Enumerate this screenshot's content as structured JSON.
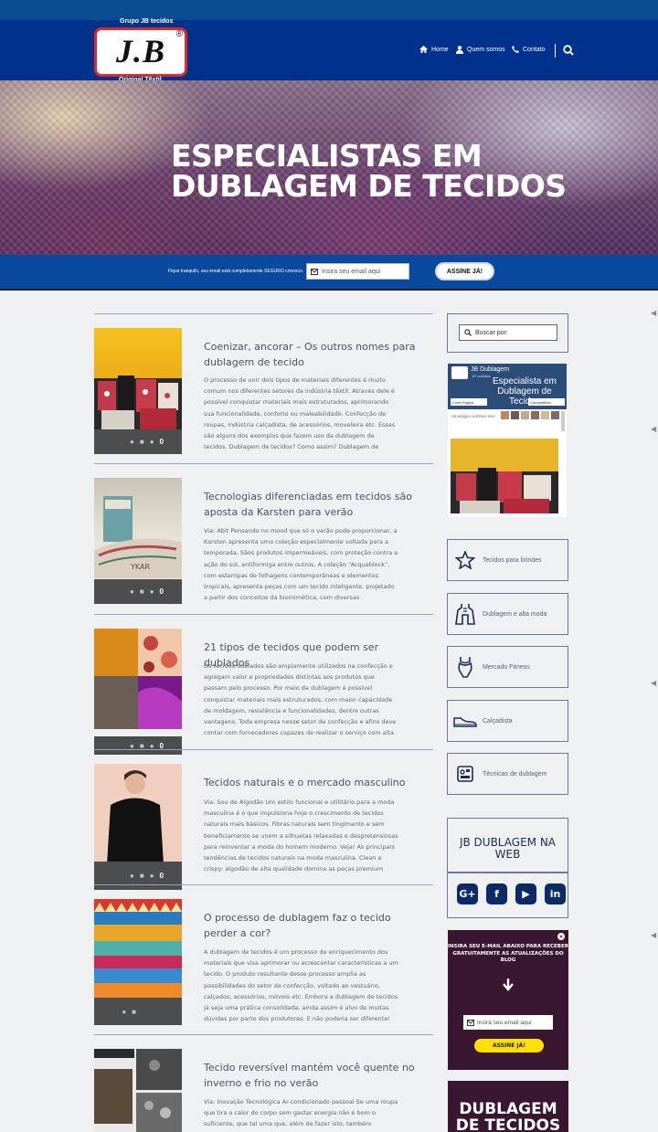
{
  "header": {
    "brand_top": "Grupo JB tecidos",
    "logo_text": "J.B",
    "logo_mark": "®",
    "brand_bottom": "Original Têxtil",
    "nav": [
      {
        "label": "Home",
        "icon": "home-icon"
      },
      {
        "label": "Quem somos",
        "icon": "user-icon"
      },
      {
        "label": "Contato",
        "icon": "phone-icon"
      }
    ],
    "search_icon": "search-icon"
  },
  "hero": {
    "title_line1": "ESPECIALISTAS EM",
    "title_line2": "DUBLAGEM DE TECIDOS"
  },
  "subscribe": {
    "note": "Fique tranquilo, seu email está completamente SEGURO conosco.",
    "placeholder": "Insira seu email aqui",
    "button": "ASSINE JÁ!"
  },
  "posts": [
    {
      "title": "Coenizar, ancorar – Os outros nomes para dublagem de tecido",
      "excerpt": "O processo de unir dois tipos de materiais diferentes é muito comum nos diferentes setores da indústria têxtil. Através dele é possível conquistar materiais mais estruturados, aprimorando sua funcionalidade, conforto ou maleabilidade. Confecção de roupas, indústria calçadista, de acessórios, moveleira etc. Esses são alguns dos exemplos que fazem uso da dublagem de tecidos. Dublagem de tecidos? Como assim? Dublagem de tecidos é o nome dado à",
      "comments": "0"
    },
    {
      "title": "Tecnologias diferenciadas em tecidos são aposta da Karsten para verão",
      "excerpt": "Via: Abit Pensando no mood que só o verão pode proporcionar, a Karsten apresenta uma coleção especialmente voltada para a temporada. Sãos produtos impermeáveis, com proteção contra a ação do sol, antiformiga entre outros. A coleção “Acquablock”, com estampas de folhagens contemporâneas e elementos tropicais, apresenta peças com um tecido inteligente, projetado a partir dos conceitos da biomimética, com diversas características",
      "comments": "0"
    },
    {
      "title": "21 tipos de tecidos que podem ser dublados",
      "excerpt": "Os tecidos dublados são amplamente utilizados na confecção e agregam valor e propriedades distintas aos produtos que passam pelo processo. Por meio da dublagem é possível conquistar materiais mais estruturados, com maior capacidade de moldagem, resistência e funcionalidades, dentre outras vantagens. Toda empresa nesse setor de confecção e afins deve contar com fornecedores capazes de realizar o serviço com alta",
      "comments": "0"
    },
    {
      "title": "Tecidos naturais e o mercado masculino",
      "excerpt": "Via: Sou de Algodão Um estilo funcional e utilitário para a moda masculina é o que impulsiona hoje o crescimento de tecidos naturais mais básicos. Fibras naturais sem tingimento e sem beneficiamento se unem a silhuetas relaxadas e despretensiosas para reinventar a moda do homem moderno. Veja! As principais tendências de tecidos naturais na moda masculina. Clean e crispy: algodão de alta qualidade domina as peças premium oferecendo",
      "comments": "0"
    },
    {
      "title": "O processo de dublagem faz o tecido perder a cor?",
      "excerpt": "A dublagem de tecidos é um processo de enriquecimento dos materiais que visa aprimorar ou acrescentar características a um tecido. O produto resultante desse processo amplia as possibilidades do setor de confecção, voltado ao vestuário, calçados, acessórios, móveis etc. Embora a dublagem de tecidos já seja uma prática consolidada, ainda assim é alvo de muitas dúvidas por parte dos produtores. E não poderia ser diferente!",
      "comments": ""
    },
    {
      "title": "Tecido reversível mantém você quente no inverno e frio no verão",
      "excerpt": "Via: Inovação Tecnológica Ar-condicionado pessoal Se uma roupa que tira o calor do corpo sem gastar energia não é bom o suficiente, que tal uma que, além de fazer isto, também mantenha",
      "comments": ""
    }
  ],
  "sidebar": {
    "search_placeholder": "Buscar por:",
    "facebook": {
      "page_name": "JB Dublagem",
      "followers": "67 curtidas",
      "header_text_line1": "Especialista em",
      "header_text_line2": "Dublagem de Tecidos",
      "like_label": "Curtir Página",
      "share_label": "Compartilhar",
      "friends_text": "15 amigos curtiram isso"
    },
    "categories": [
      {
        "label": "Tecidos para brindes",
        "icon": "star-icon"
      },
      {
        "label": "Dublagem e alta moda",
        "icon": "dress-icon"
      },
      {
        "label": "Mercado Fitness",
        "icon": "fitness-icon"
      },
      {
        "label": "Calçadista",
        "icon": "shoe-icon"
      },
      {
        "label": "Técnicas de dublagem",
        "icon": "machine-icon"
      }
    ],
    "social_title": "JB DUBLAGEM NA WEB",
    "social_links": [
      {
        "label": "G+",
        "icon": "google-plus-icon"
      },
      {
        "label": "f",
        "icon": "facebook-icon"
      },
      {
        "label": "▶",
        "icon": "youtube-icon"
      },
      {
        "label": "in",
        "icon": "linkedin-icon"
      }
    ],
    "newsletter": {
      "text": "Insira seu e-mail abaixo para receber gratuitamente as atualizações do blog",
      "placeholder": "Insira seu email aqui",
      "button": "ASSINE JÁ!",
      "close": "×"
    },
    "banner_text": "DUBLAGEM DE TECIDOS"
  }
}
